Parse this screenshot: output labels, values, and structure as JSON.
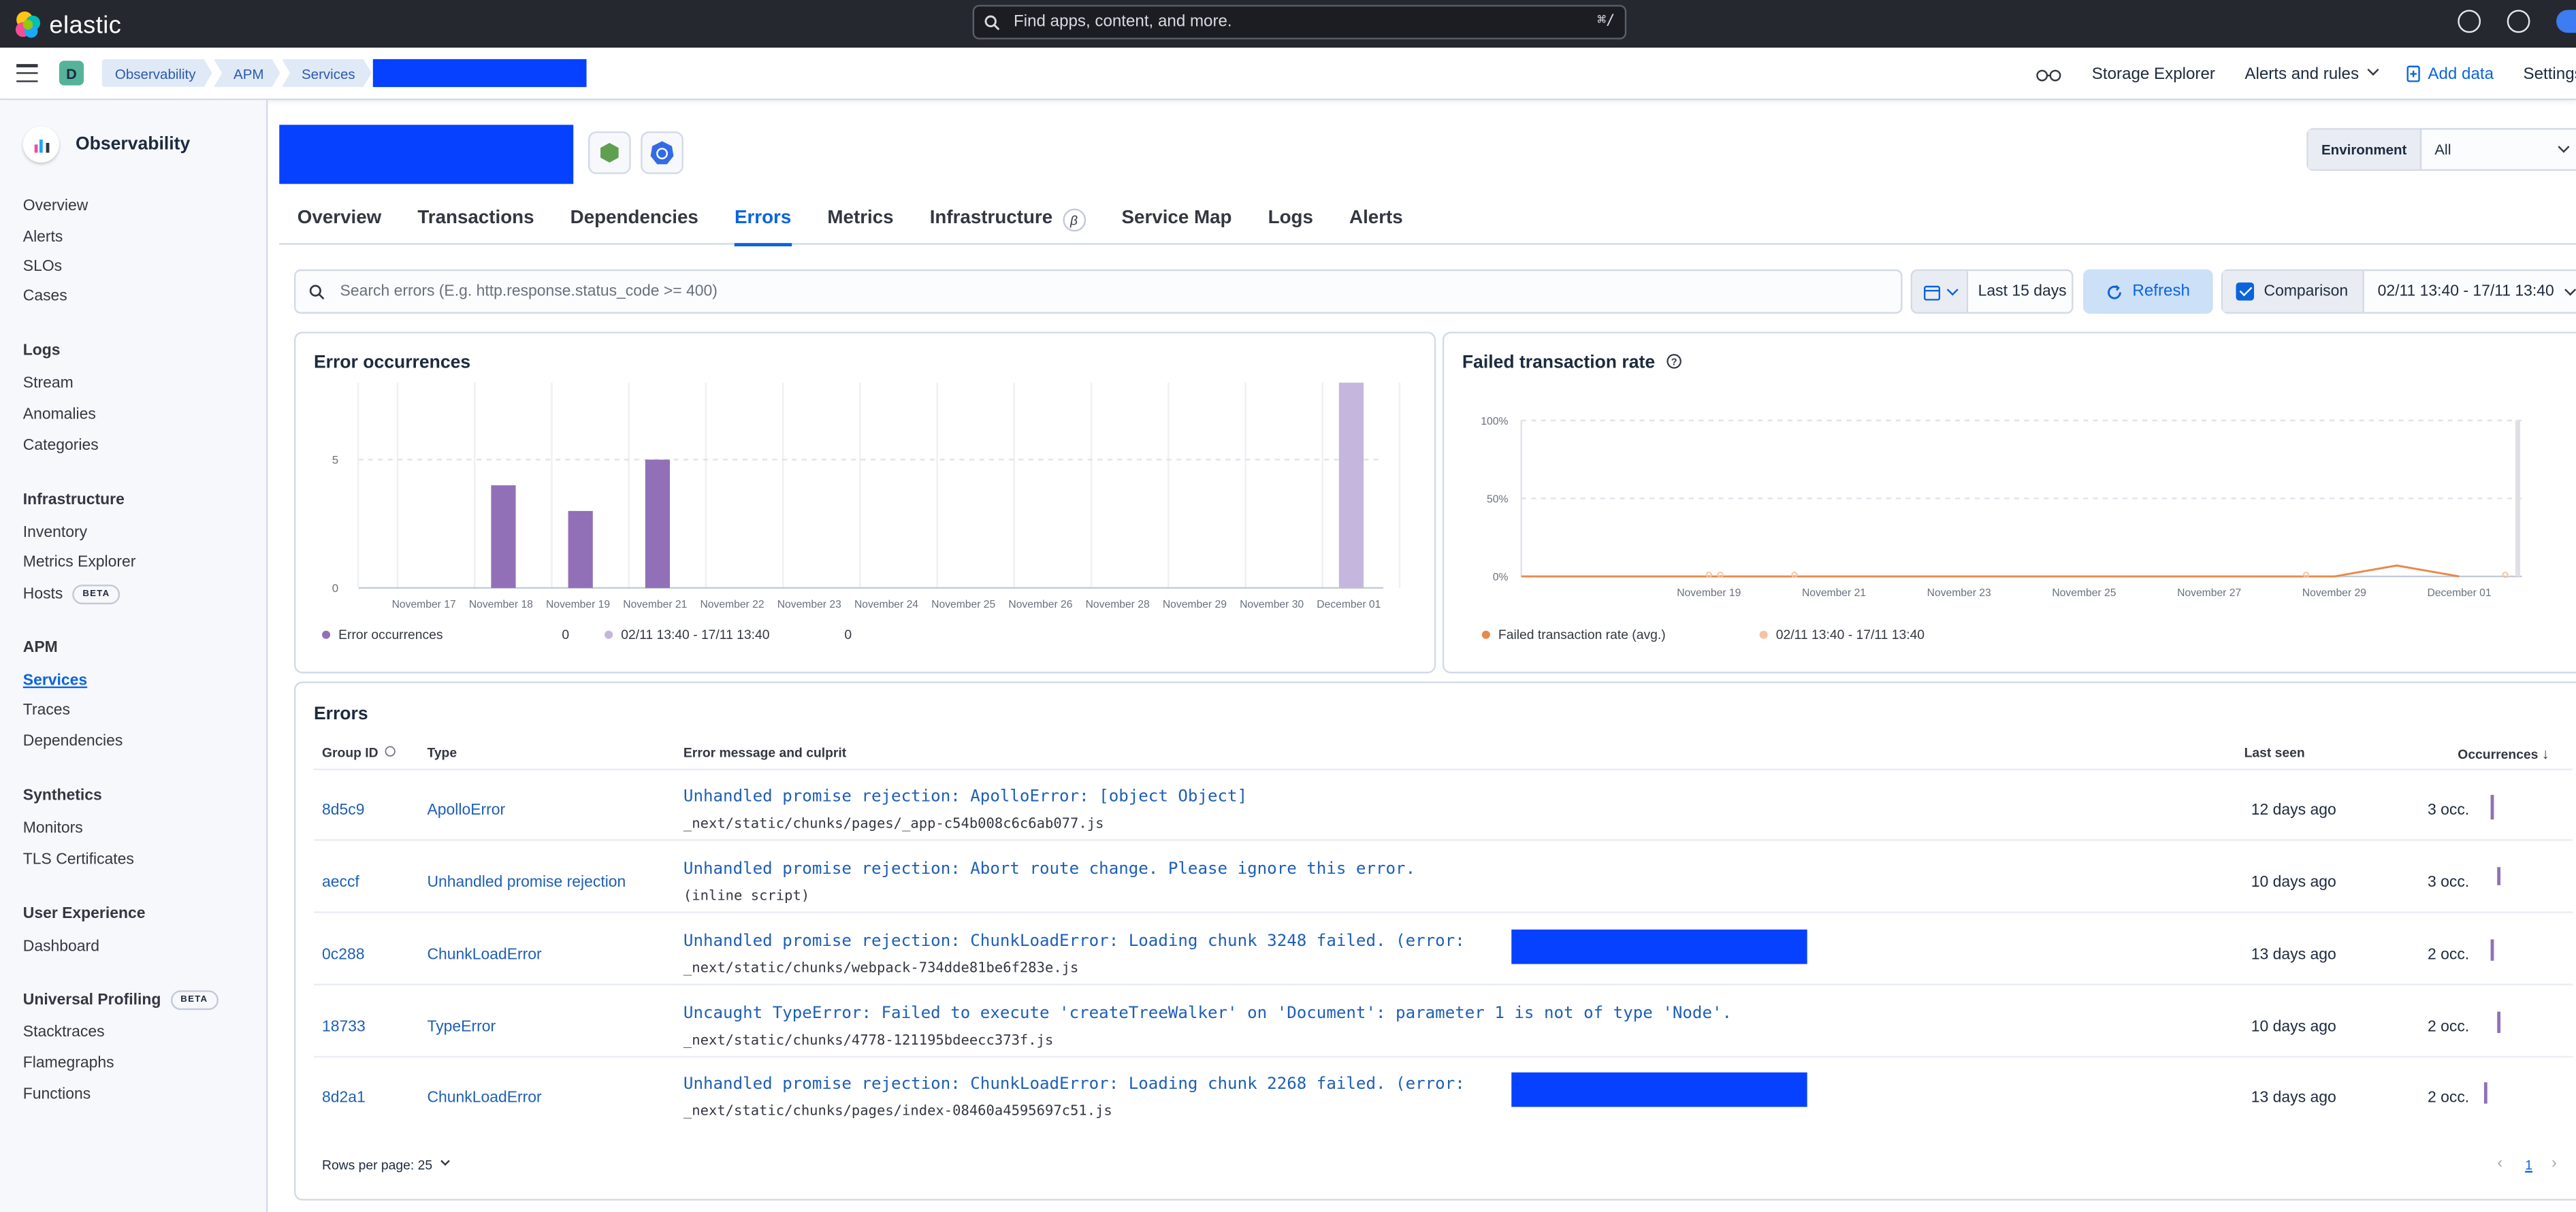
{
  "topbar": {
    "logo_text": "elastic",
    "search_placeholder": "Find apps, content, and more.",
    "search_shortcut": "⌘/"
  },
  "header": {
    "space_initial": "D",
    "breadcrumbs": [
      "Observability",
      "APM",
      "Services"
    ],
    "actions": {
      "storage_explorer": "Storage Explorer",
      "alerts_rules": "Alerts and rules",
      "add_data": "Add data",
      "settings": "Settings"
    }
  },
  "sidebar": {
    "title": "Observability",
    "top_items": [
      "Overview",
      "Alerts",
      "SLOs",
      "Cases"
    ],
    "groups": [
      {
        "title": "Logs",
        "items": [
          "Stream",
          "Anomalies",
          "Categories"
        ]
      },
      {
        "title": "Infrastructure",
        "items": [
          "Inventory",
          "Metrics Explorer",
          "Hosts"
        ]
      },
      {
        "title": "APM",
        "items": [
          "Services",
          "Traces",
          "Dependencies"
        ]
      },
      {
        "title": "Synthetics",
        "items": [
          "Monitors",
          "TLS Certificates"
        ]
      },
      {
        "title": "User Experience",
        "items": [
          "Dashboard"
        ]
      },
      {
        "title": "Universal Profiling",
        "items": [
          "Stacktraces",
          "Flamegraphs",
          "Functions"
        ]
      }
    ],
    "beta_label": "BETA",
    "active_item": "Services"
  },
  "environment": {
    "label": "Environment",
    "value": "All"
  },
  "tabs": [
    "Overview",
    "Transactions",
    "Dependencies",
    "Errors",
    "Metrics",
    "Infrastructure",
    "Service Map",
    "Logs",
    "Alerts"
  ],
  "active_tab": "Errors",
  "infra_badge": "β",
  "query": {
    "placeholder": "Search errors (E.g. http.response.status_code >= 400)"
  },
  "date_picker": {
    "label": "Last 15 days"
  },
  "refresh_label": "Refresh",
  "comparison": {
    "label": "Comparison",
    "range": "02/11 13:40 - 17/11 13:40"
  },
  "colors": {
    "bar_current": "#9170b8",
    "bar_comparison": "#c5b6de",
    "line_current": "#e7894a",
    "line_comparison": "#f4c3a1",
    "link": "#0b64dd"
  },
  "chart_data": [
    {
      "type": "bar",
      "title": "Error occurrences",
      "categories": [
        "November 17",
        "November 18",
        "November 19",
        "November 21",
        "November 22",
        "November 23",
        "November 24",
        "November 25",
        "November 26",
        "November 28",
        "November 29",
        "November 30",
        "December 01"
      ],
      "y_ticks": [
        "0",
        "5"
      ],
      "ylim": [
        0,
        8
      ],
      "series": [
        {
          "name": "Error occurrences",
          "value_label": "0",
          "points": [
            {
              "x": "November 18",
              "y": 4
            },
            {
              "x": "November 19",
              "y": 3
            },
            {
              "x": "November 21",
              "y": 5
            }
          ]
        },
        {
          "name": "02/11 13:40 - 17/11 13:40",
          "value_label": "0",
          "points": [
            {
              "x": "December 01",
              "y": 8
            }
          ]
        }
      ]
    },
    {
      "type": "line",
      "title": "Failed transaction rate",
      "x_ticks": [
        "November 19",
        "November 21",
        "November 23",
        "November 25",
        "November 27",
        "November 29",
        "December 01"
      ],
      "y_ticks": [
        "0%",
        "50%",
        "100%"
      ],
      "ylim": [
        0,
        100
      ],
      "series": [
        {
          "name": "Failed transaction rate (avg.)",
          "points": [
            {
              "x": "November 16",
              "y": 0
            },
            {
              "x": "November 29",
              "y": 0
            },
            {
              "x": "November 30",
              "y": 7
            },
            {
              "x": "December 01",
              "y": 0
            }
          ]
        },
        {
          "name": "02/11 13:40 - 17/11 13:40",
          "points": [
            {
              "x": "November 19",
              "y": 0
            },
            {
              "x": "December 01",
              "y": 0
            }
          ]
        }
      ]
    }
  ],
  "errors": {
    "title": "Errors",
    "columns": {
      "group_id": "Group ID",
      "type": "Type",
      "message": "Error message and culprit",
      "last_seen": "Last seen",
      "occurrences": "Occurrences"
    },
    "rows": [
      {
        "group_id": "8d5c9",
        "type": "ApolloError",
        "message": "Unhandled promise rejection: ApolloError: [object Object]",
        "culprit": "_next/static/chunks/pages/_app-c54b008c6c6ab077.js",
        "last_seen": "12 days ago",
        "occurrences": "3 occ."
      },
      {
        "group_id": "aeccf",
        "type": "Unhandled promise rejection",
        "message": "Unhandled promise rejection: Abort route change. Please ignore this error.",
        "culprit": "(inline script)",
        "last_seen": "10 days ago",
        "occurrences": "3 occ."
      },
      {
        "group_id": "0c288",
        "type": "ChunkLoadError",
        "message": "Unhandled promise rejection: ChunkLoadError: Loading chunk 3248 failed. (error:",
        "culprit": "_next/static/chunks/webpack-734dde81be6f283e.js",
        "last_seen": "13 days ago",
        "occurrences": "2 occ."
      },
      {
        "group_id": "18733",
        "type": "TypeError",
        "message": "Uncaught TypeError: Failed to execute 'createTreeWalker' on 'Document': parameter 1 is not of type 'Node'.",
        "culprit": "_next/static/chunks/4778-121195bdeecc373f.js",
        "last_seen": "10 days ago",
        "occurrences": "2 occ."
      },
      {
        "group_id": "8d2a1",
        "type": "ChunkLoadError",
        "message": "Unhandled promise rejection: ChunkLoadError: Loading chunk 2268 failed. (error:",
        "culprit": "_next/static/chunks/pages/index-08460a4595697c51.js",
        "last_seen": "13 days ago",
        "occurrences": "2 occ."
      }
    ],
    "rows_per_page": "Rows per page: 25",
    "current_page": "1"
  }
}
